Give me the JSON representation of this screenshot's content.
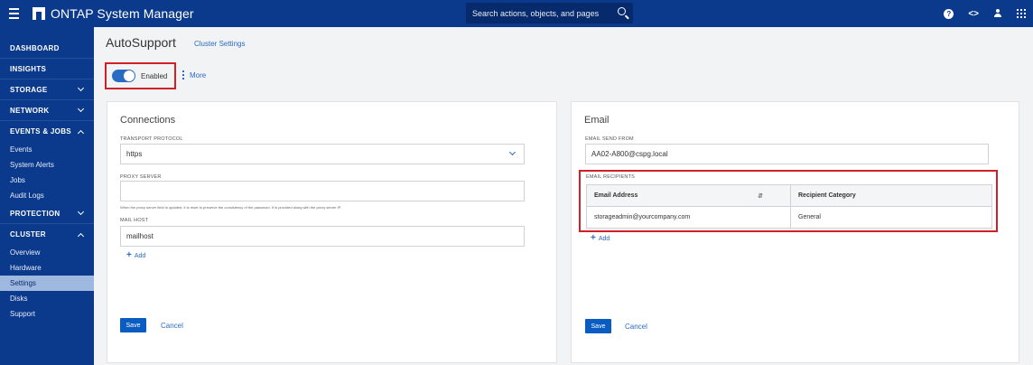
{
  "app": {
    "title": "ONTAP System Manager",
    "search_placeholder": "Search actions, objects, and pages"
  },
  "top_icons": {
    "help": "?",
    "code": "<>"
  },
  "sidebar": {
    "dashboard": "DASHBOARD",
    "insights": "INSIGHTS",
    "storage": "STORAGE",
    "network": "NETWORK",
    "events_jobs": "EVENTS & JOBS",
    "events_items": [
      "Events",
      "System Alerts",
      "Jobs",
      "Audit Logs"
    ],
    "protection": "PROTECTION",
    "cluster": "CLUSTER",
    "cluster_items": [
      "Overview",
      "Hardware",
      "Settings",
      "Disks",
      "Support"
    ]
  },
  "page": {
    "title": "AutoSupport",
    "breadcrumb": "Cluster Settings",
    "toggle_label": "Enabled",
    "toggle_on": true,
    "more_label": "More"
  },
  "connections": {
    "title": "Connections",
    "transport_label": "TRANSPORT PROTOCOL",
    "transport_value": "https",
    "proxy_label": "PROXY SERVER",
    "proxy_value": "",
    "proxy_hint": "When the proxy server field is updated, it is reset to preserve the consistency of the password. It is provided along with the proxy server IP.",
    "mailhost_label": "MAIL HOST",
    "mailhost_value": "mailhost",
    "add_label": "Add",
    "save_label": "Save",
    "cancel_label": "Cancel"
  },
  "email": {
    "title": "Email",
    "send_from_label": "EMAIL SEND FROM",
    "send_from_value": "AA02-A800@cspg.local",
    "recipients_label": "EMAIL RECIPIENTS",
    "col_address": "Email Address",
    "col_category": "Recipient Category",
    "row_address": "storageadmin@yourcompany.com",
    "row_category": "General",
    "add_label": "Add",
    "save_label": "Save",
    "cancel_label": "Cancel"
  },
  "colors": {
    "nav_bg": "#0b3a8c",
    "accent": "#2a6bc4",
    "highlight": "#d12028"
  }
}
